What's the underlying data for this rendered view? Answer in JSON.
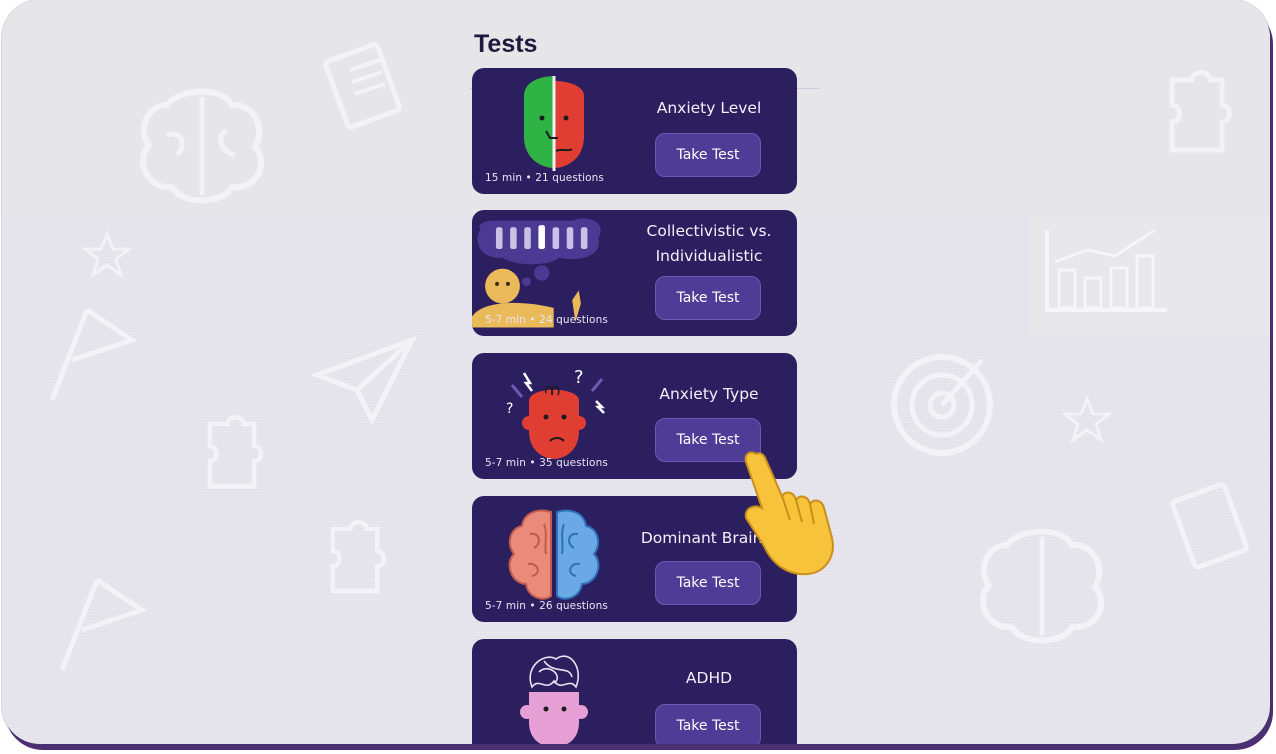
{
  "header": {
    "title": "Tests"
  },
  "cards": [
    {
      "title": "Anxiety Level",
      "meta": "15 min • 21 questions",
      "button": "Take Test",
      "art": "split-face-illustration"
    },
    {
      "title": "Collectivistic vs. Individualistic",
      "meta": "5-7 min • 24 questions",
      "button": "Take Test",
      "art": "thinking-person-illustration"
    },
    {
      "title": "Anxiety Type",
      "meta": "5-7 min • 35 questions",
      "button": "Take Test",
      "art": "worried-face-illustration"
    },
    {
      "title": "Dominant Brain S",
      "meta": "5-7 min • 26 questions",
      "button": "Take Test",
      "art": "brain-hemispheres-illustration"
    },
    {
      "title": "ADHD",
      "meta": "",
      "button": "Take Test",
      "art": "tangled-mind-illustration"
    }
  ],
  "pointer": {
    "icon": "pointing-hand-icon"
  },
  "colors": {
    "card": "#2b1f5f",
    "button": "#4e3c97",
    "title": "#1f1a3d",
    "background": "#e4e2ea"
  }
}
